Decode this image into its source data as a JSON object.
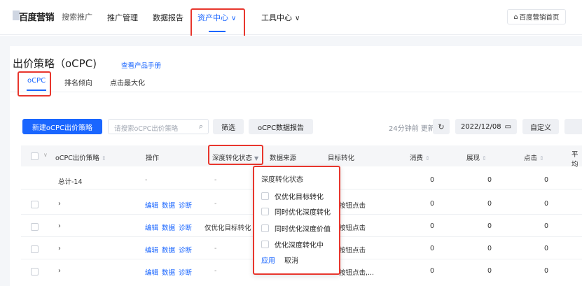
{
  "nav": {
    "logo_text": "百度营销",
    "logo_sub": "搜索推广",
    "items": [
      "推广管理",
      "数据报告",
      "资产中心",
      "工具中心"
    ],
    "active_index": 2,
    "home_label": "百度营销首页"
  },
  "page": {
    "title": "出价策略（oCPC)",
    "manual_link": "查看产品手册",
    "tabs": [
      "oCPC",
      "排名倾向",
      "点击最大化"
    ]
  },
  "toolbar": {
    "new_button": "新建oCPC出价策略",
    "search_placeholder": "请搜索oCPC出价策略",
    "filter_button": "筛选",
    "report_button": "oCPC数据报告",
    "update_text": "24分钟前 更新",
    "date": "2022/12/08",
    "custom_button": "自定义"
  },
  "table": {
    "headers": [
      "oCPC出价策略",
      "操作",
      "深度转化状态",
      "数据来源",
      "目标转化",
      "消费",
      "展现",
      "点击",
      "平均"
    ],
    "total_row": {
      "name": "总计-14",
      "op": "-",
      "deep": "-",
      "consume": "0",
      "show": "0",
      "click": "0"
    },
    "op_links": [
      "编辑",
      "数据",
      "诊断"
    ],
    "rows": [
      {
        "deep": "-",
        "target": "按钮点击",
        "consume": "0",
        "show": "0",
        "click": "0"
      },
      {
        "deep": "仅优化目标转化",
        "target": "按钮点击",
        "consume": "0",
        "show": "0",
        "click": "0"
      },
      {
        "deep": "-",
        "target": "按钮点击",
        "consume": "0",
        "show": "0",
        "click": "0"
      },
      {
        "deep": "-",
        "target": "按钮点击,...",
        "consume": "0",
        "show": "0",
        "click": "0"
      }
    ]
  },
  "dropdown": {
    "title": "深度转化状态",
    "options": [
      "仅优化目标转化",
      "同时优化深度转化",
      "同时优化深度价值",
      "优化深度转化中"
    ],
    "apply": "应用",
    "cancel": "取消"
  },
  "colors": {
    "accent": "#1a66ff",
    "highlight": "#e8362d"
  }
}
